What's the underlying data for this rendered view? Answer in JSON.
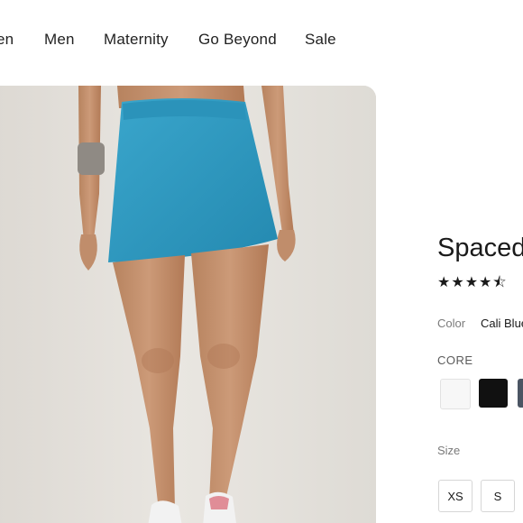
{
  "nav": {
    "items": [
      {
        "label": "en"
      },
      {
        "label": "Men"
      },
      {
        "label": "Maternity"
      },
      {
        "label": "Go Beyond"
      },
      {
        "label": "Sale"
      }
    ]
  },
  "product": {
    "title": "Spaced",
    "rating_stars": "★★★★⯪",
    "rating_value": 4.5,
    "color_label": "Color",
    "color_value": "Cali Blue",
    "collection_label": "CORE",
    "swatches": [
      {
        "name": "white",
        "color": "#f7f7f7"
      },
      {
        "name": "black",
        "color": "#111111"
      },
      {
        "name": "slate",
        "color": "#4b5563"
      }
    ],
    "size_label": "Size",
    "sizes": [
      "XS",
      "S"
    ]
  },
  "image": {
    "skirt_color": "#2f9bc2",
    "background_color": "#e4e1dc"
  }
}
